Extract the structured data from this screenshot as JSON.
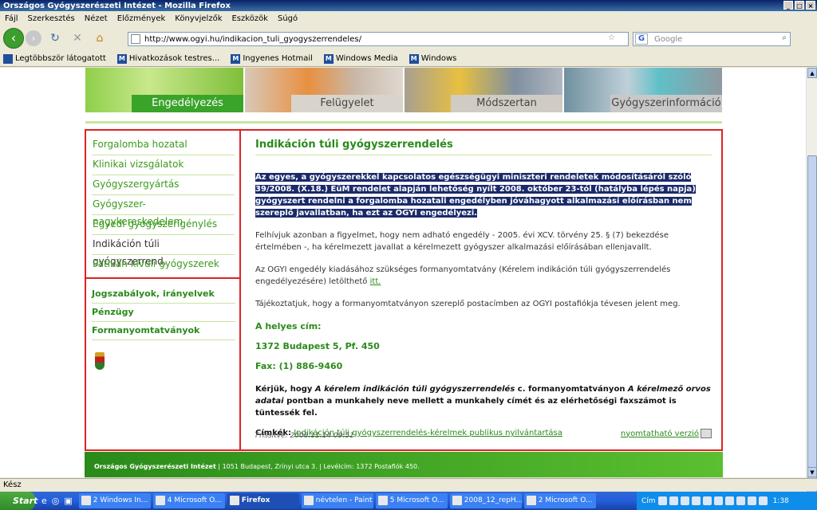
{
  "window": {
    "title": "Országos Gyógyszerészeti Intézet - Mozilla Firefox"
  },
  "menu": [
    "Fájl",
    "Szerkesztés",
    "Nézet",
    "Előzmények",
    "Könyvjelzők",
    "Eszközök",
    "Súgó"
  ],
  "address": {
    "url": "http://www.ogyi.hu/indikacion_tuli_gyogyszerrendeles/"
  },
  "search": {
    "placeholder": "Google"
  },
  "bookmarks": [
    "Legtöbbször látogatott",
    "Hivatkozások testres...",
    "Ingyenes Hotmail",
    "Windows Media",
    "Windows"
  ],
  "banner": [
    "Engedélyezés",
    "Felügyelet",
    "Módszertan",
    "Gyógyszerinformáció"
  ],
  "sidebar": {
    "items": [
      "Forgalomba hozatal",
      "Klinikai vizsgálatok",
      "Gyógyszergyártás",
      "Gyógyszer-nagykereskedelem",
      "Egyedi gyógyszerigénylés",
      "Indikáción túli gyógyszerrend.",
      "Patikán kívüli gyógyszerek"
    ],
    "sub": [
      "Jogszabályok, irányelvek",
      "Pénzügy",
      "Formanyomtatványok"
    ]
  },
  "content": {
    "title": "Indikáción túli gyógyszerrendelés",
    "highlight": "Az egyes, a gyógyszerekkel kapcsolatos egészségügyi miniszteri rendeletek módosításáról szóló 39/2008. (X.18.) EüM rendelet alapján lehetőség nyílt 2008. október 23-tól (hatályba lépés napja) gyógyszert rendelni a forgalomba hozatali engedélyben jóváhagyott alkalmazási előírásban nem szereplő javallatban, ha ezt az OGYI engedélyezi.",
    "p1": "Felhívjuk azonban a figyelmet, hogy nem adható engedély - 2005. évi XCV. törvény 25. § (7) bekezdése értelmében -, ha kérelmezett javallat a kérelmezett gyógyszer alkalmazási előírásában ellenjavallt.",
    "p2": "Az OGYI engedély kiadásához szükséges formanyomtatvány (Kérelem indikáción túli gyógyszerrendelés engedélyezésére) letölthető",
    "p2_link": "itt.",
    "p3": "Tájékoztatjuk, hogy a formanyomtatványon szereplő postacímben az OGYI postafiókja tévesen jelent meg.",
    "addr_label": "A helyes cím:",
    "addr": "1372 Budapest 5, Pf. 450",
    "fax": "Fax: (1) 886-9460",
    "request_a": "Kérjük, hogy ",
    "request_b": "A kérelem indikáción túli gyógyszerrendelés",
    "request_c": " c. formanyomtatványon ",
    "request_d": "A kérelmező orvos adatai",
    "request_e": " pontban a munkahely neve mellett a munkahely címét és az elérhetőségi faxszámot is tüntessék fel.",
    "tags_label": "Címkék:",
    "tags_link": "Indikáción túli gyógyszerrendelés-kérelmek publikus nyilvántartása",
    "updated": "Frissítve: 2008.11.14 09:51",
    "print": "nyomtatható verzió"
  },
  "footer": {
    "org": "Országos Gyógyszerészeti Intézet",
    "addr": " | 1051 Budapest, Zrínyi utca 3.  |  Levélcím: 1372 Postafiók 450."
  },
  "status": "Kész",
  "taskbar": {
    "start": "Start",
    "items": [
      "2 Windows In...",
      "4 Microsoft O...",
      "Firefox",
      "névtelen - Paint",
      "5 Microsoft O...",
      "2008_12_repH...",
      "2 Microsoft O..."
    ],
    "tray_label": "Cím",
    "clock": "1:38"
  }
}
